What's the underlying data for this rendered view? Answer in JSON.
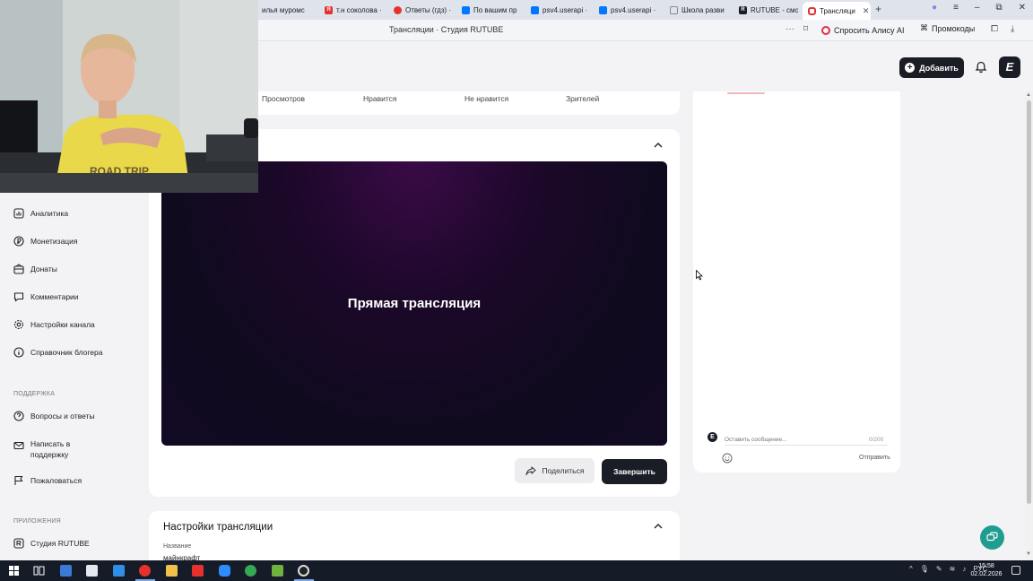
{
  "browser": {
    "tabs": [
      {
        "label": "илья муромс",
        "fav_color": "#7a3bd8",
        "fav_text": ""
      },
      {
        "label": "т.н соколова ·",
        "fav_color": "#e5322d",
        "fav_text": "Я"
      },
      {
        "label": "Ответы (гдз) ·",
        "fav_color": "#e5322d",
        "fav_text": ""
      },
      {
        "label": "По вашим пр",
        "fav_color": "#0077ff",
        "fav_text": "VK"
      },
      {
        "label": "psv4.userapi ·",
        "fav_color": "#0077ff",
        "fav_text": "VK"
      },
      {
        "label": "psv4.userapi ·",
        "fav_color": "#0077ff",
        "fav_text": "VK"
      },
      {
        "label": "Школа разви",
        "fav_color": "#9aa0aa",
        "fav_text": ""
      },
      {
        "label": "RUTUBE - смо",
        "fav_color": "#1a1d26",
        "fav_text": "R"
      },
      {
        "label": "Трансляци",
        "fav_color": "#e5322d",
        "fav_text": ""
      }
    ],
    "page_title": "Трансляции · Студия RUTUBE",
    "alice_label": "Спросить Алису AI",
    "promo_label": "Промокоды"
  },
  "header": {
    "add_label": "Добавить",
    "logo_glyph": "E"
  },
  "sidebar": {
    "items": [
      {
        "label": "Аналитика",
        "icon": "analytics-icon"
      },
      {
        "label": "Монетизация",
        "icon": "monetization-icon"
      },
      {
        "label": "Донаты",
        "icon": "donate-icon"
      },
      {
        "label": "Комментарии",
        "icon": "comments-icon"
      },
      {
        "label": "Настройки канала",
        "icon": "settings-icon"
      },
      {
        "label": "Справочник блогера",
        "icon": "info-icon"
      }
    ],
    "support_heading": "ПОДДЕРЖКА",
    "support_items": [
      {
        "label": "Вопросы и ответы",
        "icon": "question-icon"
      },
      {
        "label": "Написать в поддержку",
        "icon": "mail-icon"
      },
      {
        "label": "Пожаловаться",
        "icon": "flag-icon"
      }
    ],
    "apps_heading": "ПРИЛОЖЕНИЯ",
    "apps_items": [
      {
        "label": "Студия RUTUBE",
        "icon": "studio-icon"
      }
    ]
  },
  "stats": {
    "views": "Просмотров",
    "likes": "Нравится",
    "dislikes": "Не нравится",
    "viewers": "Зрителей"
  },
  "live": {
    "player_title": "Прямая трансляция",
    "share_label": "Поделиться",
    "end_label": "Завершить"
  },
  "settings": {
    "title": "Настройки трансляции",
    "name_label": "Название",
    "name_value": "майнкрафт"
  },
  "chat": {
    "placeholder": "Оставить сообщение...",
    "counter": "0/200",
    "send_label": "Отправить",
    "avatar_glyph": "E"
  },
  "taskbar": {
    "lang": "РУС",
    "time": "15:58",
    "date": "02.02.2026"
  },
  "colors": {
    "accent_dark": "#1a1d26",
    "player_purple": "#3a0a47",
    "support_teal": "#1f9d8f"
  }
}
